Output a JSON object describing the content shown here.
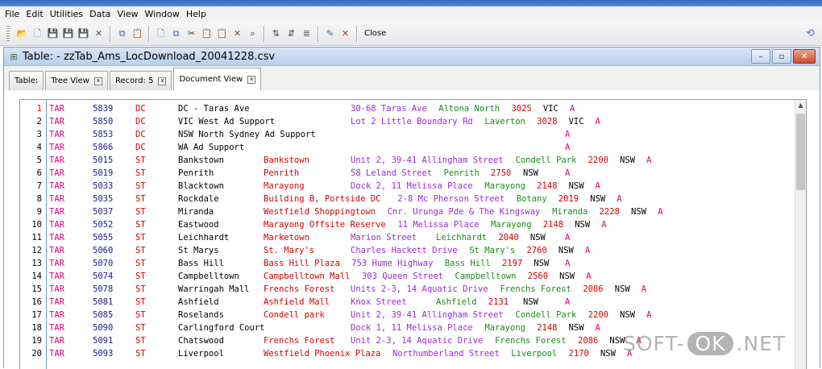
{
  "menu": [
    "File",
    "Edit",
    "Utilities",
    "Data",
    "View",
    "Window",
    "Help"
  ],
  "toolbar": {
    "groups": [
      [
        {
          "name": "open-folder",
          "glyph": "📂",
          "color": "#c89a2b"
        },
        {
          "name": "new-document",
          "glyph": "🗋",
          "color": "#4a6fb5"
        },
        {
          "name": "save",
          "glyph": "💾",
          "color": "#2a4f9a"
        },
        {
          "name": "save-all",
          "glyph": "💾",
          "color": "#3b7a3b"
        },
        {
          "name": "save-as",
          "glyph": "💾",
          "color": "#6a4aa0"
        },
        {
          "name": "delete-x",
          "glyph": "✕",
          "color": "#555555"
        }
      ],
      [
        {
          "name": "copy",
          "glyph": "⧉",
          "color": "#3a62b0"
        },
        {
          "name": "paste-clipboard",
          "glyph": "📋",
          "color": "#b07a2a"
        }
      ],
      [
        {
          "name": "blank-page",
          "glyph": "🗋",
          "color": "#4a6fb5"
        },
        {
          "name": "copy-doc",
          "glyph": "⧉",
          "color": "#3a62b0"
        },
        {
          "name": "cut",
          "glyph": "✂",
          "color": "#333333"
        },
        {
          "name": "paste",
          "glyph": "📋",
          "color": "#b07a2a"
        },
        {
          "name": "paste-special",
          "glyph": "📋",
          "color": "#2f8f2f"
        },
        {
          "name": "delete",
          "glyph": "✕",
          "color": "#555555"
        },
        {
          "name": "find",
          "glyph": "⌕",
          "color": "#222222"
        }
      ],
      [
        {
          "name": "sort",
          "glyph": "⇅",
          "color": "#444444"
        },
        {
          "name": "sort-desc",
          "glyph": "⇵",
          "color": "#444444"
        },
        {
          "name": "list",
          "glyph": "≣",
          "color": "#555555"
        }
      ],
      [
        {
          "name": "edit-doc",
          "glyph": "✎",
          "color": "#3a62b0"
        },
        {
          "name": "tools",
          "glyph": "✕",
          "color": "#b03030"
        }
      ]
    ],
    "close_label": "Close",
    "right_icon": "⟲"
  },
  "window": {
    "title": "Table: - zzTab_Ams_LocDownload_20041228.csv",
    "icon": "⊞",
    "buttons": [
      "–",
      "▫",
      "✕"
    ]
  },
  "tabs": [
    {
      "label": "Table:",
      "closable": false,
      "active": false
    },
    {
      "label": "Tree View",
      "closable": true,
      "active": false
    },
    {
      "label": "Record: 5",
      "closable": true,
      "active": false
    },
    {
      "label": "Document View",
      "closable": true,
      "active": true
    }
  ],
  "tab_close_glyph": "x",
  "colors": {
    "black": "#000000",
    "magenta": "#e0007a",
    "navy": "#1a1a8c",
    "red": "#d40000",
    "purple": "#9a2ad4",
    "green": "#1a8c1a"
  },
  "columns": [
    {
      "key": "type",
      "color": "magenta"
    },
    {
      "key": "code",
      "color": "navy"
    },
    {
      "key": "kind",
      "color": "red"
    },
    {
      "key": "name",
      "color": "black"
    },
    {
      "key": "f5",
      "color": "red"
    },
    {
      "key": "f6",
      "color": "purple"
    },
    {
      "key": "f7",
      "color": "green"
    },
    {
      "key": "f8",
      "color": "red"
    },
    {
      "key": "f9",
      "color": "black"
    },
    {
      "key": "f10",
      "color": "magenta"
    }
  ],
  "rows": [
    {
      "n": "1",
      "cells": [
        "TAR",
        "5839",
        "DC",
        "DC - Taras Ave",
        "",
        "30-68 Taras Ave",
        "Altona North",
        "3025",
        "VIC",
        "A"
      ]
    },
    {
      "n": "2",
      "cells": [
        "TAR",
        "5850",
        "DC",
        "VIC West Ad Support",
        "",
        "Lot 2 Little Boundary Rd",
        "Laverton",
        "3028",
        "VIC",
        "A"
      ]
    },
    {
      "n": "3",
      "cells": [
        "TAR",
        "5853",
        "DC",
        "NSW North Sydney Ad Support",
        "",
        "",
        "",
        "",
        "",
        "A"
      ]
    },
    {
      "n": "4",
      "cells": [
        "TAR",
        "5866",
        "DC",
        "WA Ad Support",
        "",
        "",
        "",
        "",
        "",
        "A"
      ]
    },
    {
      "n": "5",
      "cells": [
        "TAR",
        "5015",
        "ST",
        "Bankstown",
        "Bankstown",
        "Unit 2, 39-41 Allingham Street",
        "Condell Park",
        "2200",
        "NSW",
        "A"
      ]
    },
    {
      "n": "6",
      "cells": [
        "TAR",
        "5019",
        "ST",
        "Penrith",
        "Penrith",
        "58 Leland Street",
        "Penrith",
        "2750",
        "NSW",
        "A"
      ]
    },
    {
      "n": "7",
      "cells": [
        "TAR",
        "5033",
        "ST",
        "Blacktown",
        "Marayong",
        "Dock 2, 11 Melissa Place",
        "Marayong",
        "2148",
        "NSW",
        "A"
      ]
    },
    {
      "n": "8",
      "cells": [
        "TAR",
        "5035",
        "ST",
        "Rockdale",
        "Building B,  Portside DC",
        "2-8 Mc Pherson Street",
        "Botany",
        "2019",
        "NSW",
        "A"
      ]
    },
    {
      "n": "9",
      "cells": [
        "TAR",
        "5037",
        "ST",
        "Miranda",
        "Westfield Shoppingtown",
        "Cnr. Urunga Pde & The Kingsway",
        "Miranda",
        "2228",
        "NSW",
        "A"
      ]
    },
    {
      "n": "10",
      "cells": [
        "TAR",
        "5052",
        "ST",
        "Eastwood",
        "Marayong Offsite Reserve",
        "11 Melissa Place",
        "Marayong",
        "2148",
        "NSW",
        "A"
      ]
    },
    {
      "n": "11",
      "cells": [
        "TAR",
        "5055",
        "ST",
        "Leichhardt",
        "Marketown",
        "Marion Street",
        "Leichhardt",
        "2040",
        "NSW",
        "A"
      ]
    },
    {
      "n": "12",
      "cells": [
        "TAR",
        "5060",
        "ST",
        "St Marys",
        "St. Mary's",
        "Charles Hackett Drive",
        "St Mary's",
        "2760",
        "NSW",
        "A"
      ]
    },
    {
      "n": "13",
      "cells": [
        "TAR",
        "5070",
        "ST",
        "Bass Hill",
        "Bass Hill Plaza",
        "753 Hume Highway",
        "Bass Hill",
        "2197",
        "NSW",
        "A"
      ]
    },
    {
      "n": "14",
      "cells": [
        "TAR",
        "5074",
        "ST",
        "Campbelltown",
        "Campbelltown Mall",
        "303 Queen Street",
        "Campbelltown",
        "2560",
        "NSW",
        "A"
      ]
    },
    {
      "n": "15",
      "cells": [
        "TAR",
        "5078",
        "ST",
        "Warringah Mall",
        "Frenchs Forest",
        "Units 2-3, 14 Aquatic Drive",
        "Frenchs Forest",
        "2086",
        "NSW",
        "A"
      ]
    },
    {
      "n": "16",
      "cells": [
        "TAR",
        "5081",
        "ST",
        "Ashfield",
        "Ashfield Mall",
        "Knox Street",
        "Ashfield",
        "2131",
        "NSW",
        "A"
      ]
    },
    {
      "n": "17",
      "cells": [
        "TAR",
        "5085",
        "ST",
        "Roselands",
        "Condell park",
        "Unit 2, 39-41 Allingham Street",
        "Condell Park",
        "2200",
        "NSW",
        "A"
      ]
    },
    {
      "n": "18",
      "cells": [
        "TAR",
        "5090",
        "ST",
        "Carlingford Court",
        "",
        "Dock 1, 11 Melissa Place",
        "Marayong",
        "2148",
        "NSW",
        "A"
      ]
    },
    {
      "n": "19",
      "cells": [
        "TAR",
        "5091",
        "ST",
        "Chatswood",
        "Frenchs Forest",
        "Unit 2-3, 14 Aquatic Drive",
        "Frenchs Forest",
        "2086",
        "NSW",
        "A"
      ]
    },
    {
      "n": "20",
      "cells": [
        "TAR",
        "5093",
        "ST",
        "Liverpool",
        "Westfield Phoenix Plaza",
        "Northumberland Street",
        "Liverpool",
        "2170",
        "NSW",
        "A"
      ]
    }
  ],
  "watermark": {
    "left": "SOFT-",
    "ok": "OK",
    "right": ".NET"
  }
}
